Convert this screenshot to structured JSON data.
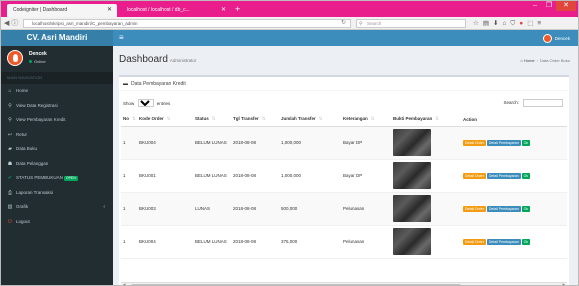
{
  "browser": {
    "tabs": [
      {
        "title": "Codeigniter | Dashboard",
        "active": true
      },
      {
        "title": "localhost / localhost / db_c...",
        "active": false
      }
    ],
    "url": "localhost/skripsi_asri_mandiri/C_pembayaran_admin",
    "search_placeholder": "Search",
    "window_buttons": [
      "–",
      "❐",
      "✕"
    ]
  },
  "brand": "CV. Asri Mandiri",
  "user": {
    "name": "Dencek",
    "status": "Online"
  },
  "sidebar": {
    "header": "MAIN NAVIGATION",
    "items": [
      {
        "icon": "home-icon",
        "glyph": "⌂",
        "label": "Home"
      },
      {
        "icon": "search-icon",
        "glyph": "⚲",
        "label": "View Data Registrasi"
      },
      {
        "icon": "search-icon",
        "glyph": "⚲",
        "label": "View Pembayaran Kredit"
      },
      {
        "icon": "retur-icon",
        "glyph": "↩",
        "label": "Retur"
      },
      {
        "icon": "book-icon",
        "glyph": "▰",
        "label": "Data Buku"
      },
      {
        "icon": "users-icon",
        "glyph": "☗",
        "label": "Data Pelanggan"
      },
      {
        "icon": "check-icon",
        "glyph": "✔",
        "label": "STATUS PEMBUKUAN",
        "badge": "OPEN"
      },
      {
        "icon": "print-icon",
        "glyph": "⎙",
        "label": "Laporan Transaksi"
      },
      {
        "icon": "chart-icon",
        "glyph": "▥",
        "label": "Grafik",
        "arrow": "‹"
      },
      {
        "icon": "logout-icon",
        "glyph": "⏻",
        "label": "Logout"
      }
    ]
  },
  "topnav": {
    "menu_glyph": "≡",
    "user": "Dencek"
  },
  "page": {
    "title": "Dashboard",
    "subtitle": "Administrator",
    "breadcrumb": {
      "home": "Home",
      "current": "Data Order Buku"
    }
  },
  "box": {
    "title": "Data Pembayaran Kredit",
    "show_label": "Show",
    "show_value": "10",
    "entries_label": "entries",
    "search_label": "Search:"
  },
  "table": {
    "columns": [
      "No",
      "Kode Order",
      "Status",
      "Tgl Transfer",
      "Jumlah Transfer",
      "Keterangan",
      "Bukti Pembayaran",
      "Action"
    ],
    "rows": [
      {
        "no": "1",
        "kode": "BKU004",
        "status": "BELUM LUNAS",
        "tgl": "2018-08-08",
        "jumlah": "1,000,000",
        "ket": "Bayar DP"
      },
      {
        "no": "1",
        "kode": "BKU001",
        "status": "BELUM LUNAS",
        "tgl": "2018-08-08",
        "jumlah": "1,000,000",
        "ket": "Bayar DP"
      },
      {
        "no": "1",
        "kode": "BKU003",
        "status": "LUNAS",
        "tgl": "2018-08-08",
        "jumlah": "500,000",
        "ket": "Pelunasan"
      },
      {
        "no": "1",
        "kode": "BKU004",
        "status": "BELUM LUNAS",
        "tgl": "2018-08-08",
        "jumlah": "375,000",
        "ket": "Pelunasan"
      }
    ],
    "actions": {
      "order": "Detail Order",
      "bayar": "Detail Pembayaran",
      "ok": "Ok"
    }
  },
  "colors": {
    "tab_strip": "#e91e8c",
    "navbar": "#3c8dbc",
    "brand": "#367fa9",
    "sidebar": "#222d32",
    "btn_order": "#f39c12",
    "btn_bayar": "#3c8dbc",
    "btn_ok": "#00a65a"
  }
}
